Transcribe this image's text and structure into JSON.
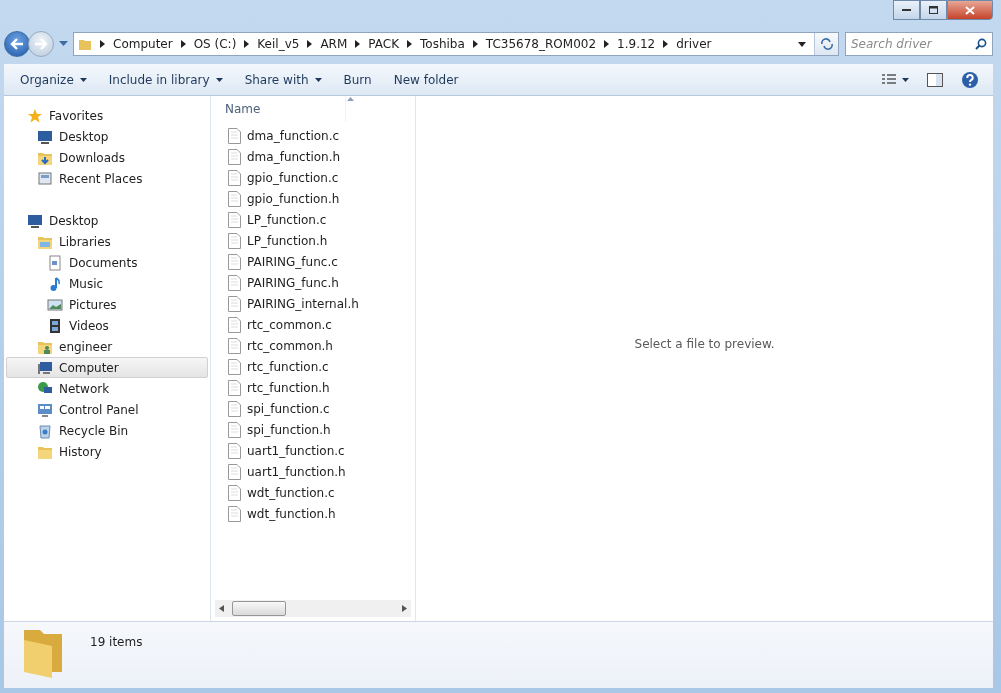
{
  "address": {
    "segments": [
      "Computer",
      "OS (C:)",
      "Keil_v5",
      "ARM",
      "PACK",
      "Toshiba",
      "TC35678_ROM002",
      "1.9.12",
      "driver"
    ]
  },
  "search": {
    "placeholder": "Search driver"
  },
  "toolbar": {
    "buttons": [
      {
        "label": "Organize",
        "has_menu": true
      },
      {
        "label": "Include in library",
        "has_menu": true
      },
      {
        "label": "Share with",
        "has_menu": true
      },
      {
        "label": "Burn",
        "has_menu": false
      },
      {
        "label": "New folder",
        "has_menu": false
      }
    ]
  },
  "sidebar": {
    "groups": [
      {
        "label": "Favorites",
        "selected": false,
        "children": [
          {
            "label": "Desktop",
            "selected": false
          },
          {
            "label": "Downloads",
            "selected": false
          },
          {
            "label": "Recent Places",
            "selected": false
          }
        ]
      },
      {
        "label": "Desktop",
        "selected": false,
        "children": [
          {
            "label": "Libraries",
            "selected": false,
            "children": [
              {
                "label": "Documents",
                "selected": false
              },
              {
                "label": "Music",
                "selected": false
              },
              {
                "label": "Pictures",
                "selected": false
              },
              {
                "label": "Videos",
                "selected": false
              }
            ]
          },
          {
            "label": "engineer",
            "selected": false
          },
          {
            "label": "Computer",
            "selected": true
          },
          {
            "label": "Network",
            "selected": false
          },
          {
            "label": "Control Panel",
            "selected": false
          },
          {
            "label": "Recycle Bin",
            "selected": false
          },
          {
            "label": "History",
            "selected": false
          }
        ]
      }
    ]
  },
  "file_list": {
    "column": "Name",
    "files": [
      "dma_function.c",
      "dma_function.h",
      "gpio_function.c",
      "gpio_function.h",
      "LP_function.c",
      "LP_function.h",
      "PAIRING_func.c",
      "PAIRING_func.h",
      "PAIRING_internal.h",
      "rtc_common.c",
      "rtc_common.h",
      "rtc_function.c",
      "rtc_function.h",
      "spi_function.c",
      "spi_function.h",
      "uart1_function.c",
      "uart1_function.h",
      "wdt_function.c",
      "wdt_function.h"
    ]
  },
  "preview": {
    "message": "Select a file to preview."
  },
  "details": {
    "count": "19 items"
  }
}
